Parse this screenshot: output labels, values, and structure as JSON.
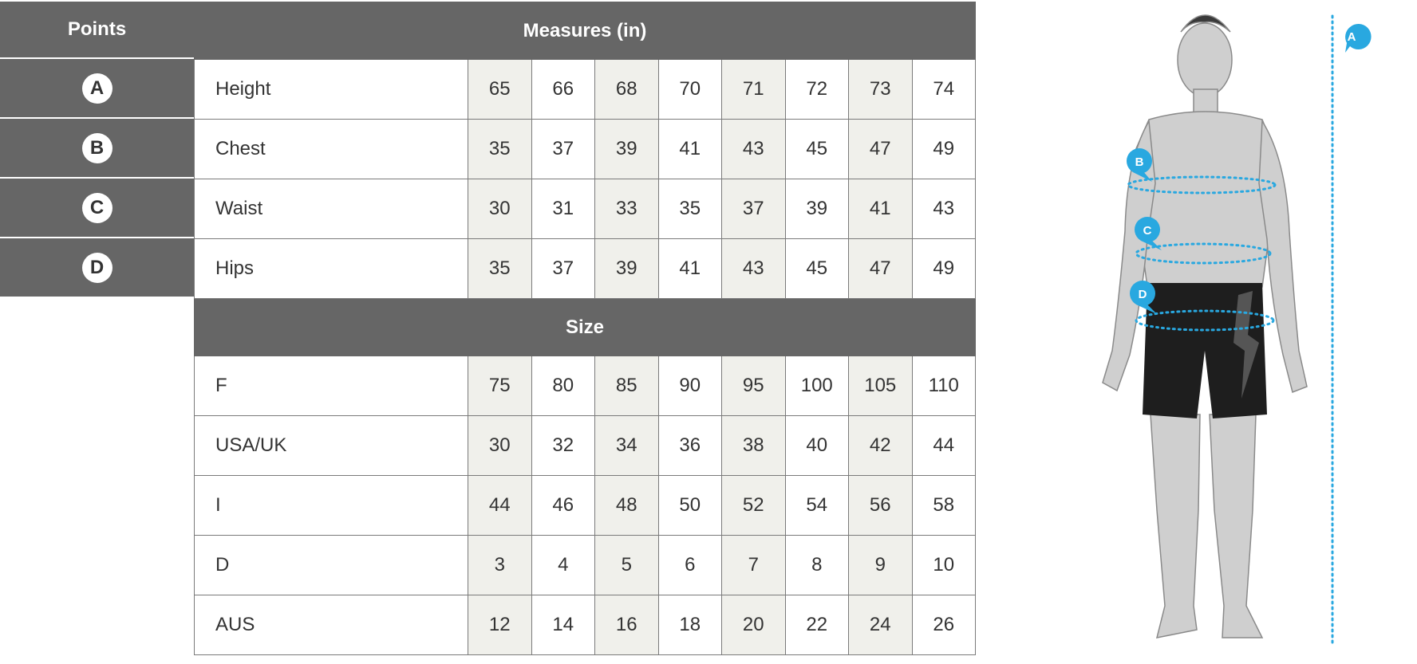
{
  "points": {
    "header": "Points",
    "items": [
      "A",
      "B",
      "C",
      "D"
    ]
  },
  "measures": {
    "header": "Measures (in)",
    "rows": [
      {
        "label": "Height",
        "values": [
          "65",
          "66",
          "68",
          "70",
          "71",
          "72",
          "73",
          "74"
        ]
      },
      {
        "label": "Chest",
        "values": [
          "35",
          "37",
          "39",
          "41",
          "43",
          "45",
          "47",
          "49"
        ]
      },
      {
        "label": "Waist",
        "values": [
          "30",
          "31",
          "33",
          "35",
          "37",
          "39",
          "41",
          "43"
        ]
      },
      {
        "label": "Hips",
        "values": [
          "35",
          "37",
          "39",
          "41",
          "43",
          "45",
          "47",
          "49"
        ]
      }
    ]
  },
  "size": {
    "header": "Size",
    "rows": [
      {
        "label": "F",
        "values": [
          "75",
          "80",
          "85",
          "90",
          "95",
          "100",
          "105",
          "110"
        ]
      },
      {
        "label": "USA/UK",
        "values": [
          "30",
          "32",
          "34",
          "36",
          "38",
          "40",
          "42",
          "44"
        ]
      },
      {
        "label": "I",
        "values": [
          "44",
          "46",
          "48",
          "50",
          "52",
          "54",
          "56",
          "58"
        ]
      },
      {
        "label": "D",
        "values": [
          "3",
          "4",
          "5",
          "6",
          "7",
          "8",
          "9",
          "10"
        ]
      },
      {
        "label": "AUS",
        "values": [
          "12",
          "14",
          "16",
          "18",
          "20",
          "22",
          "24",
          "26"
        ]
      }
    ]
  },
  "figure": {
    "callouts": [
      "A",
      "B",
      "C",
      "D"
    ],
    "accent_color": "#29a8e0"
  },
  "colors": {
    "header_bg": "#666666",
    "shaded_cell": "#f0f0eb"
  }
}
